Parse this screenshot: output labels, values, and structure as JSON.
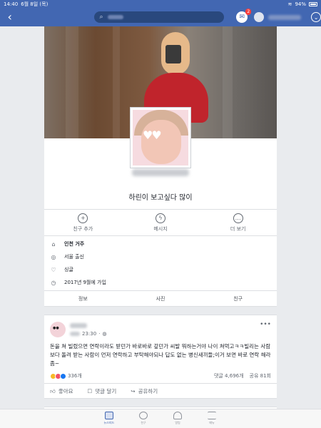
{
  "status_bar": {
    "time": "14:40",
    "date": "6월 8일 (목)",
    "battery": "94%"
  },
  "nav": {
    "search_icon": "search-icon",
    "messenger_badge": "2"
  },
  "profile": {
    "bio": "하린이 보고싶다 많이",
    "actions": [
      {
        "label": "친구 추가",
        "icon": "add-friend-icon"
      },
      {
        "label": "메시지",
        "icon": "messenger-icon"
      },
      {
        "label": "더 보기",
        "icon": "more-icon"
      }
    ],
    "info": [
      {
        "text": "인천 거주",
        "icon": "home-icon"
      },
      {
        "text": "서울 출신",
        "icon": "location-icon"
      },
      {
        "text": "싱글",
        "icon": "heart-icon"
      },
      {
        "text": "2017년 9월에 가입",
        "icon": "clock-icon"
      }
    ],
    "tabs": [
      "정보",
      "사진",
      "친구"
    ]
  },
  "post": {
    "time": "23:30",
    "text": "돈을 쳐 빌렸으면 연락이라도 받던가 바로바로 갚던가 씨발 뭐하는거야 나이 쳐먹고ㅋㅋ빌리는 사람보다 돌려 받는 사람이 먼저 연락하고 부탁해야되나 답도 없는 병신새끼들;이거 보면 바로 연락 해라 좀~",
    "reactions_count": "336개",
    "comments": "댓글 4,696개",
    "shares": "공유 81회",
    "actions": [
      "좋아요",
      "댓글 달기",
      "공유하기"
    ]
  },
  "tabbar": [
    {
      "label": "뉴스피드",
      "active": true
    },
    {
      "label": "친구",
      "active": false
    },
    {
      "label": "알림",
      "active": false
    },
    {
      "label": "메뉴",
      "active": false
    }
  ],
  "colors": {
    "brand": "#4267b2",
    "love": "#f25268",
    "like": "#1877f2",
    "haha": "#f7b928"
  }
}
